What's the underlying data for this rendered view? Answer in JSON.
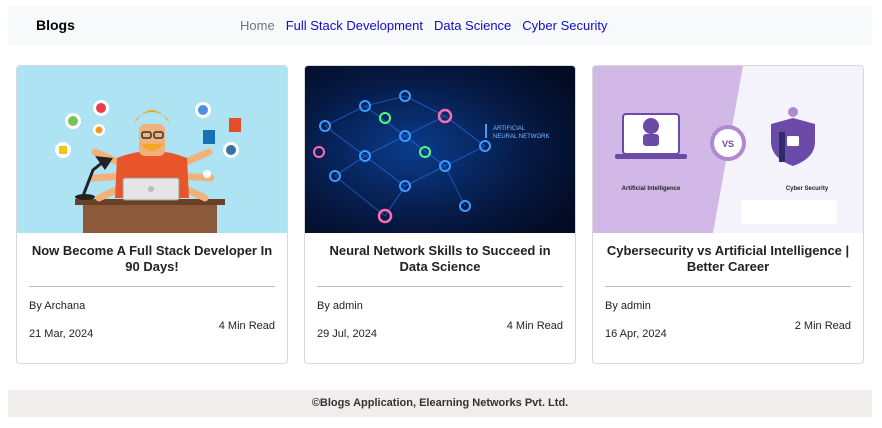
{
  "navbar": {
    "brand": "Blogs",
    "links": [
      {
        "label": "Home"
      },
      {
        "label": "Full Stack Development"
      },
      {
        "label": "Data Science"
      },
      {
        "label": "Cyber Security"
      }
    ]
  },
  "posts": [
    {
      "title": "Now Become A Full Stack Developer In 90 Days!",
      "author": "By Archana",
      "date": "21 Mar, 2024",
      "read_time": "4 Min Read",
      "image": "full-stack-developer-illustration"
    },
    {
      "title": "Neural Network Skills to Succeed in Data Science",
      "author": "By admin",
      "date": "29 Jul, 2024",
      "read_time": "4 Min Read",
      "image": "artificial-neural-network-illustration",
      "image_text": "ARTIFICIAL NEURAL NETWORK"
    },
    {
      "title": "Cybersecurity vs Artificial Intelligence | Better Career",
      "author": "By admin",
      "date": "16 Apr, 2024",
      "read_time": "2 Min Read",
      "image": "ai-vs-cyber-security-illustration",
      "image_labels": {
        "left": "Artificial Intelligence",
        "vs": "VS",
        "right": "Cyber Security"
      }
    }
  ],
  "footer": {
    "text": "©Blogs Application, Elearning Networks Pvt. Ltd."
  },
  "colors": {
    "navbar_bg": "#f8f9fa",
    "link": "#0d0dcc",
    "home_link": "#6c757d",
    "footer_bg": "#f1eded"
  }
}
